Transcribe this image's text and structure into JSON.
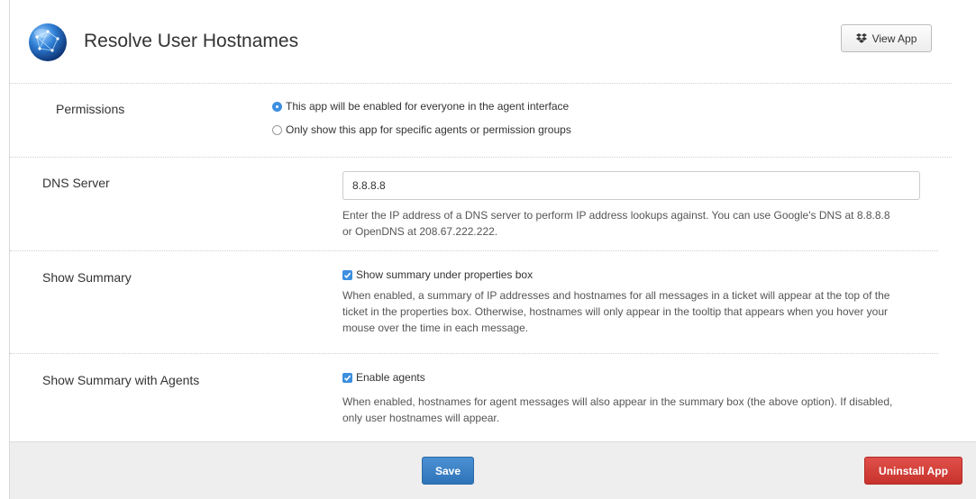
{
  "header": {
    "title": "Resolve User Hostnames",
    "view_app_label": "View App",
    "view_app_icon": "dropbox-icon",
    "logo_icon": "globe-network-icon"
  },
  "permissions": {
    "label": "Permissions",
    "options": [
      {
        "label": "This app will be enabled for everyone in the agent interface",
        "selected": true
      },
      {
        "label": "Only show this app for specific agents or permission groups",
        "selected": false
      }
    ]
  },
  "dns_server": {
    "label": "DNS Server",
    "value": "8.8.8.8",
    "help_line1": "Enter the IP address of a DNS server to perform IP address lookups against. You can use Google's DNS at 8.8.8.8",
    "help_line2": "or OpenDNS at 208.67.222.222."
  },
  "show_summary": {
    "label": "Show Summary",
    "checkbox_label": "Show summary under properties box",
    "checked": true,
    "help_line1": "When enabled, a summary of IP addresses and hostnames for all messages in a ticket will appear at the top of the",
    "help_line2": "ticket in the properties box. Otherwise, hostnames will only appear in the tooltip that appears when you hover your",
    "help_line3": "mouse over the time in each message."
  },
  "show_summary_agents": {
    "label": "Show Summary with Agents",
    "checkbox_label": "Enable agents",
    "checked": true,
    "help_line1": "When enabled, hostnames for agent messages will also appear in the summary box (the above option). If disabled,",
    "help_line2": "only user hostnames will appear."
  },
  "footer": {
    "save_label": "Save",
    "uninstall_label": "Uninstall App"
  },
  "colors": {
    "accent_blue": "#3d8fe0",
    "save_button": "#2f74b8",
    "uninstall_button": "#c8322d",
    "footer_bg": "#eeeeee"
  }
}
